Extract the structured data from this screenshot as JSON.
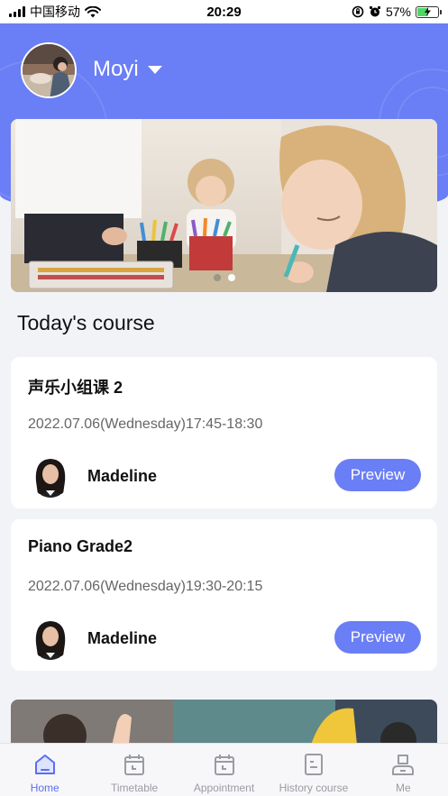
{
  "status_bar": {
    "carrier": "中国移动",
    "time": "20:29",
    "battery_percent": "57%",
    "battery_level": 0.57,
    "battery_color": "#4cd964",
    "icons": [
      "signal-icon",
      "wifi-icon",
      "screen-lock-icon",
      "alarm-icon",
      "battery-icon"
    ]
  },
  "header": {
    "username": "Moyi",
    "background_color": "#6a7ef5"
  },
  "banner": {
    "active_slide": 1,
    "slide_count": 2
  },
  "section": {
    "title": "Today's course"
  },
  "courses": [
    {
      "name": "声乐小组课 2",
      "time": "2022.07.06(Wednesday)17:45-18:30",
      "teacher": "Madeline",
      "action": "Preview"
    },
    {
      "name": "Piano Grade2",
      "time": "2022.07.06(Wednesday)19:30-20:15",
      "teacher": "Madeline",
      "action": "Preview"
    }
  ],
  "tab_bar": {
    "active_color": "#5a6ff0",
    "inactive_color": "#9a9ca3",
    "tabs": [
      {
        "label": "Home",
        "icon": "home-icon",
        "active": true
      },
      {
        "label": "Timetable",
        "icon": "calendar-icon",
        "active": false
      },
      {
        "label": "Appointment",
        "icon": "calendar-check-icon",
        "active": false
      },
      {
        "label": "History course",
        "icon": "document-icon",
        "active": false
      },
      {
        "label": "Me",
        "icon": "person-icon",
        "active": false
      }
    ]
  }
}
